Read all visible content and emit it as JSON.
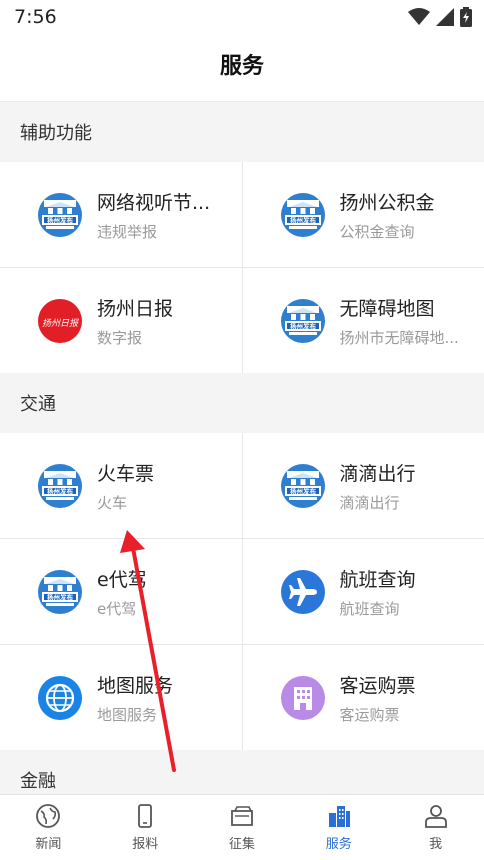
{
  "status": {
    "time": "7:56"
  },
  "header": {
    "title": "服务"
  },
  "sections": [
    {
      "title": "辅助功能",
      "items": [
        {
          "title": "网络视听节...",
          "subtitle": "违规举报",
          "icon": "yangzhou-fabu-icon"
        },
        {
          "title": "扬州公积金",
          "subtitle": "公积金查询",
          "icon": "yangzhou-fabu-icon"
        },
        {
          "title": "扬州日报",
          "subtitle": "数字报",
          "icon": "yangzhou-ribao-icon",
          "icon_text": "扬州日报"
        },
        {
          "title": "无障碍地图",
          "subtitle": "扬州市无障碍地...",
          "icon": "yangzhou-fabu-icon"
        }
      ]
    },
    {
      "title": "交通",
      "items": [
        {
          "title": "火车票",
          "subtitle": "火车",
          "icon": "yangzhou-fabu-icon"
        },
        {
          "title": "滴滴出行",
          "subtitle": "滴滴出行",
          "icon": "yangzhou-fabu-icon"
        },
        {
          "title": "e代驾",
          "subtitle": "e代驾",
          "icon": "yangzhou-fabu-icon"
        },
        {
          "title": "航班查询",
          "subtitle": "航班查询",
          "icon": "airplane-icon"
        },
        {
          "title": "地图服务",
          "subtitle": "地图服务",
          "icon": "globe-icon"
        },
        {
          "title": "客运购票",
          "subtitle": "客运购票",
          "icon": "building-icon"
        }
      ]
    },
    {
      "title": "金融"
    }
  ],
  "fabu_text": "扬州发布",
  "tabs": [
    {
      "label": "新闻",
      "icon": "globe-icon"
    },
    {
      "label": "报料",
      "icon": "phone-icon"
    },
    {
      "label": "征集",
      "icon": "folder-icon"
    },
    {
      "label": "服务",
      "icon": "buildings-icon",
      "active": true
    },
    {
      "label": "我",
      "icon": "person-icon"
    }
  ],
  "colors": {
    "accent": "#2a6fd6",
    "arrow": "#e8202a"
  }
}
